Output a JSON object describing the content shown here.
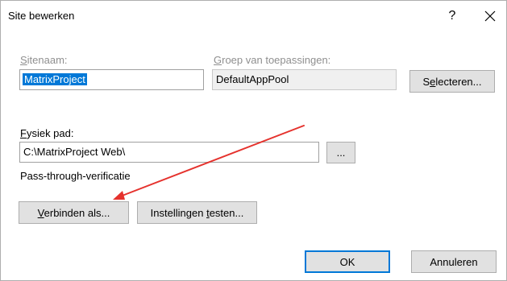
{
  "window": {
    "title": "Site bewerken",
    "help_label": "?"
  },
  "site_name": {
    "label_first": "S",
    "label_rest": "itenaam:",
    "value": "MatrixProject"
  },
  "app_pool": {
    "label_first": "G",
    "label_rest": "roep van toepassingen:",
    "value": "DefaultAppPool",
    "select_button_first": "S",
    "select_button_ul": "e",
    "select_button_rest": "lecteren..."
  },
  "physical_path": {
    "label_first": "F",
    "label_rest": "ysiek pad:",
    "value": "C:\\MatrixProject Web\\",
    "browse_label": "..."
  },
  "auth": {
    "text": "Pass-through-verificatie"
  },
  "connect_as_button": {
    "ul": "V",
    "rest": "erbinden als..."
  },
  "test_settings_button": {
    "before": "Instellingen ",
    "ul": "t",
    "after": "esten..."
  },
  "footer": {
    "ok_label": "OK",
    "cancel_label": "Annuleren"
  },
  "colors": {
    "selection": "#0078d7",
    "annotation_arrow": "#e5322d"
  }
}
